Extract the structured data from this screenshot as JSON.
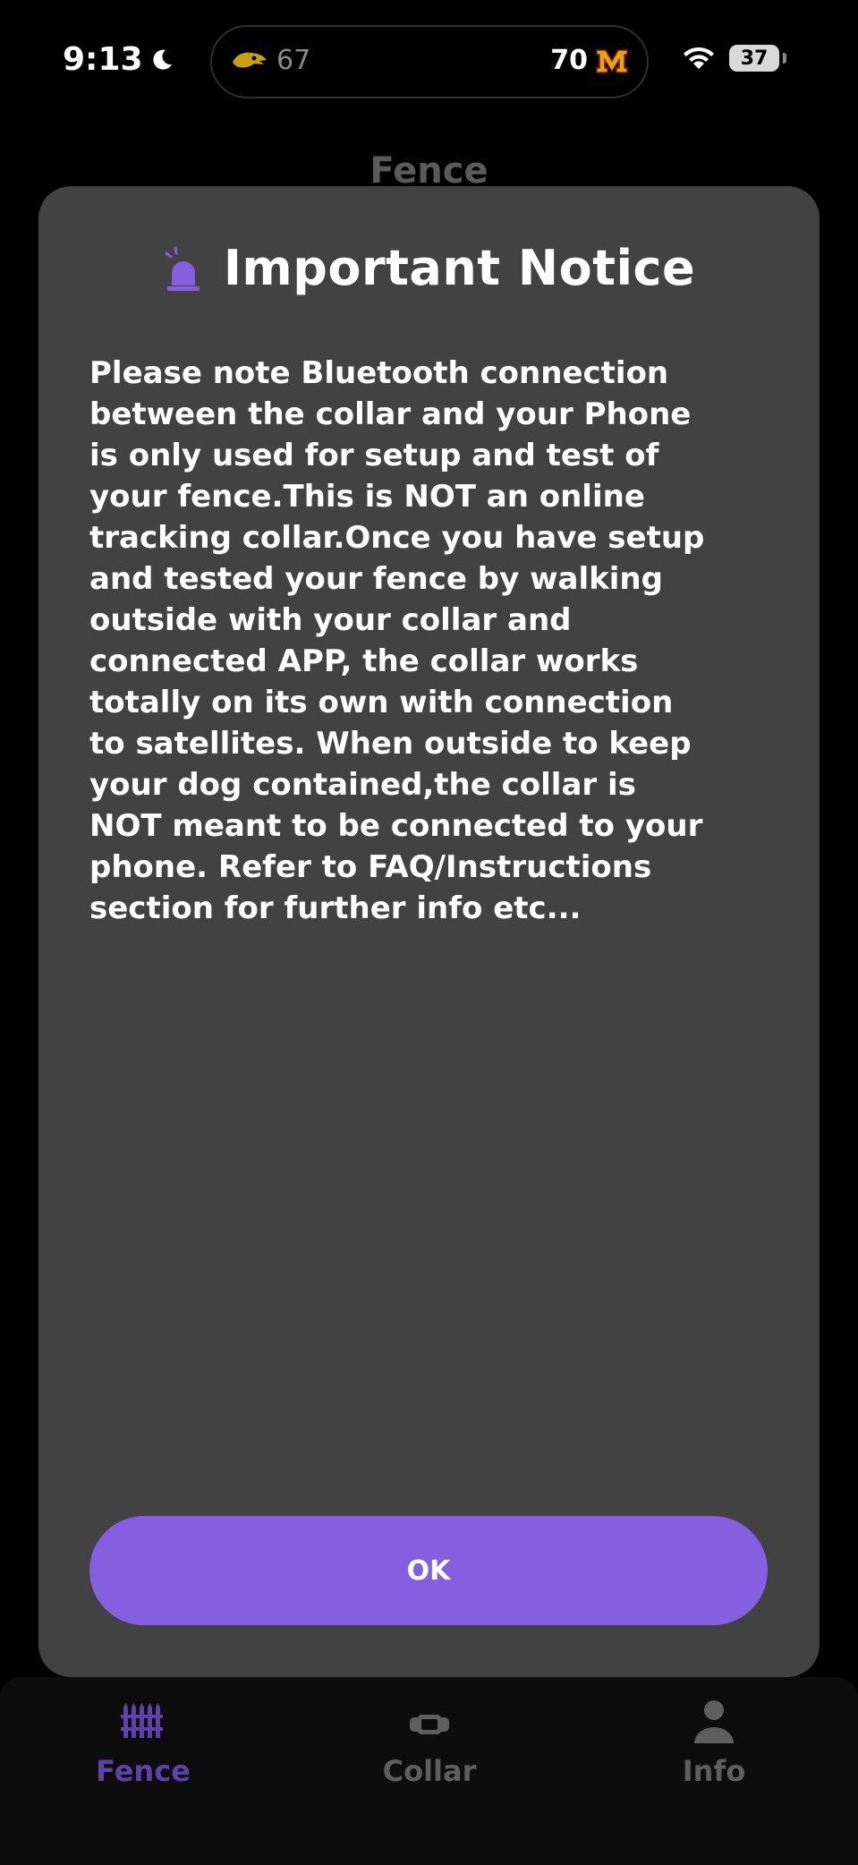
{
  "status_bar": {
    "time": "9:13",
    "score_left": "67",
    "score_right": "70",
    "battery": "37"
  },
  "page": {
    "title": "Fence"
  },
  "modal": {
    "title": "Important Notice",
    "body": "Please note Bluetooth connection\nbetween the collar and your Phone\nis only used for setup and test of\nyour fence.This is NOT an online\ntracking collar.Once you have setup\nand tested your fence by walking\noutside with your collar and\nconnected APP, the collar works\ntotally on its own with connection\nto satellites. When outside to keep\nyour dog contained,the collar is\nNOT meant to be connected to your\nphone. Refer to FAQ/Instructions\nsection for further info etc...",
    "ok_label": "OK"
  },
  "tabs": [
    {
      "label": "Fence",
      "icon": "fence-icon",
      "active": true
    },
    {
      "label": "Collar",
      "icon": "collar-icon",
      "active": false
    },
    {
      "label": "Info",
      "icon": "person-icon",
      "active": false
    }
  ],
  "colors": {
    "accent": "#8460e0",
    "active_tab": "#5d43a8",
    "modal_bg": "#424242",
    "background": "#000000"
  }
}
